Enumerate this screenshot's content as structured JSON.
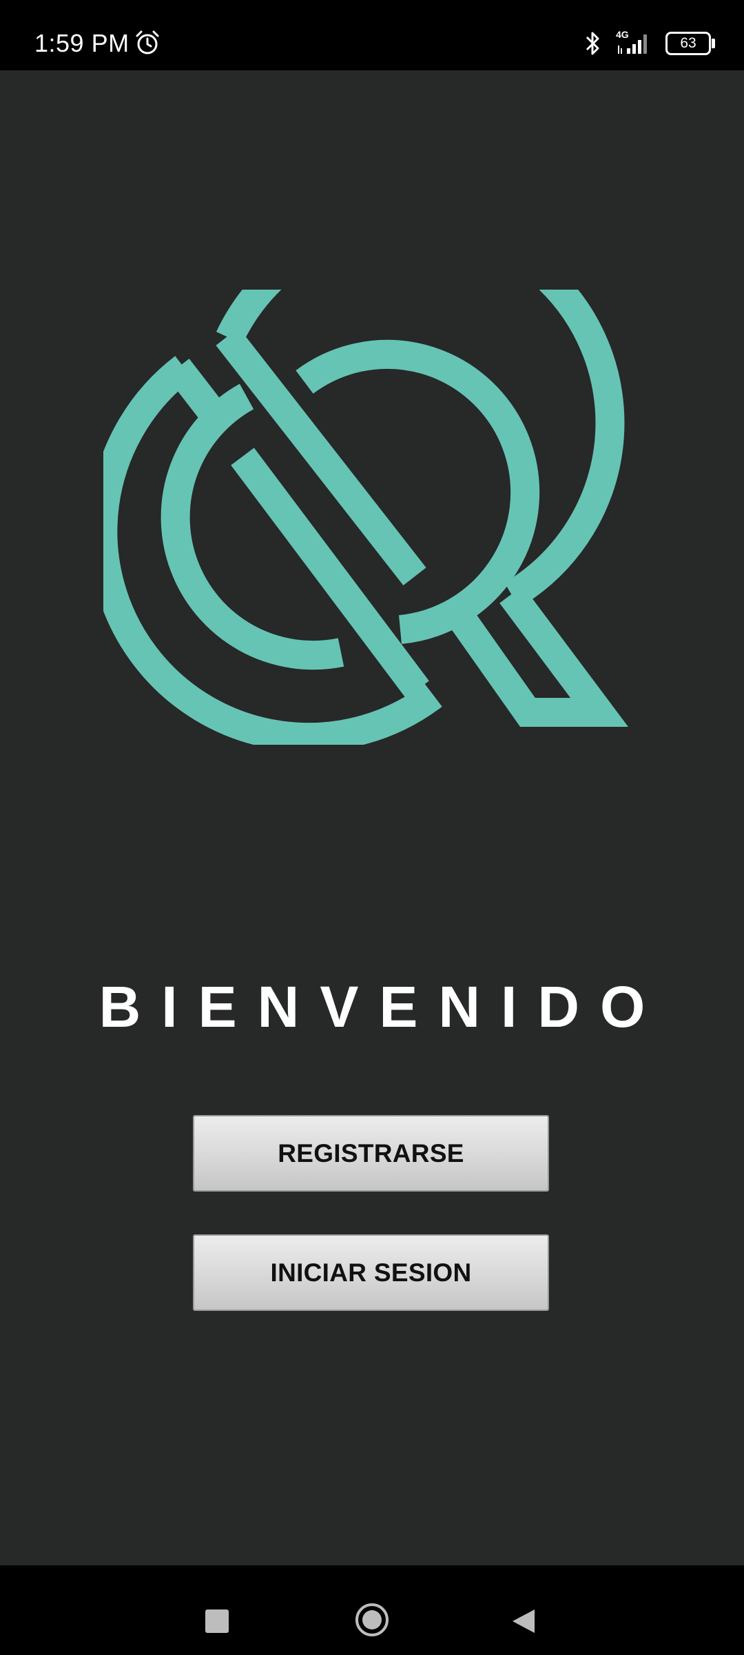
{
  "status_bar": {
    "time": "1:59 PM",
    "network": "4G",
    "battery": "63",
    "icons": [
      "alarm-icon",
      "bluetooth-icon",
      "signal-icon",
      "battery-icon"
    ]
  },
  "welcome": {
    "title": "BIENVENIDO"
  },
  "buttons": {
    "register": "REGISTRARSE",
    "login": "INICIAR SESION"
  },
  "nav_bar": {
    "icons": [
      "recents-icon",
      "home-icon",
      "back-icon"
    ]
  },
  "colors": {
    "background": "#272828",
    "logo": "#66c4b4",
    "status_bar": "#000000",
    "button_face": "#d8d8d8",
    "button_text": "#111111"
  }
}
